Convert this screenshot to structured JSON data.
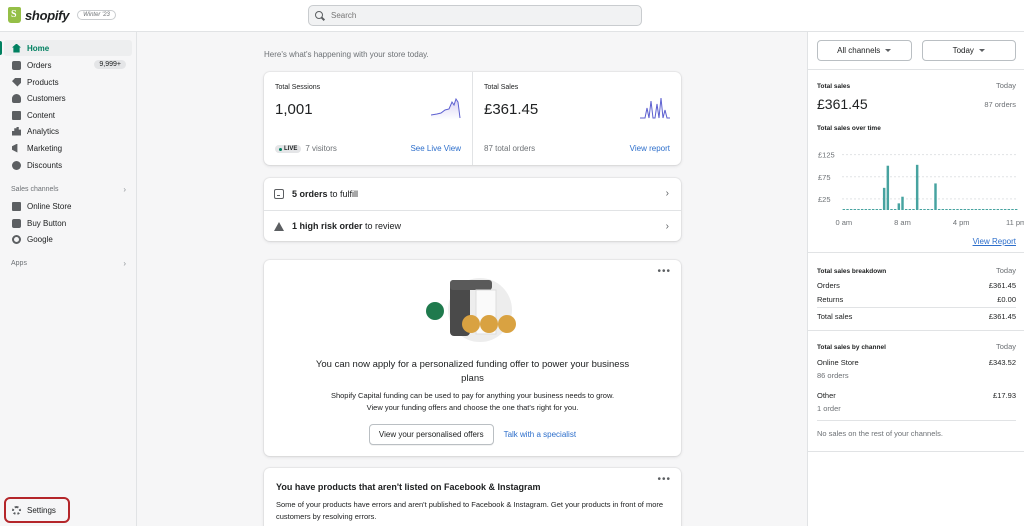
{
  "topbar": {
    "brand": "shopify",
    "edition_badge": "Winter '23",
    "search_placeholder": "Search"
  },
  "sidebar": {
    "items": [
      {
        "label": "Home",
        "icon": "home-icon"
      },
      {
        "label": "Orders",
        "icon": "orders-icon",
        "badge": "9,999+"
      },
      {
        "label": "Products",
        "icon": "tag-icon"
      },
      {
        "label": "Customers",
        "icon": "person-icon"
      },
      {
        "label": "Content",
        "icon": "content-icon"
      },
      {
        "label": "Analytics",
        "icon": "bar-chart-icon"
      },
      {
        "label": "Marketing",
        "icon": "megaphone-icon"
      },
      {
        "label": "Discounts",
        "icon": "discount-icon"
      }
    ],
    "sales_channels_heading": "Sales channels",
    "channels": [
      {
        "label": "Online Store",
        "icon": "store-icon"
      },
      {
        "label": "Buy Button",
        "icon": "buy-button-icon"
      },
      {
        "label": "Google",
        "icon": "google-icon"
      }
    ],
    "apps_heading": "Apps",
    "settings_label": "Settings"
  },
  "main": {
    "intro": "Here's what's happening with your store today.",
    "sessions": {
      "label": "Total Sessions",
      "value": "1,001",
      "live_badge": "LIVE",
      "visitors": "7 visitors",
      "link": "See Live View"
    },
    "sales": {
      "label": "Total Sales",
      "value": "£361.45",
      "orders": "87 total orders",
      "link": "View report"
    },
    "todos": [
      {
        "bold": "5 orders",
        "rest": " to fulfill"
      },
      {
        "bold": "1 high risk order",
        "rest": " to review"
      }
    ],
    "promo": {
      "title": "You can now apply for a personalized funding offer to power your business plans",
      "body": "Shopify Capital funding can be used to pay for anything your business needs to grow. View your funding offers and choose the one that's right for you.",
      "primary_button": "View your personalised offers",
      "secondary_link": "Talk with a specialist"
    },
    "facebook": {
      "title": "You have products that aren't listed on Facebook & Instagram",
      "body": "Some of your products have errors and aren't published to Facebook & Instagram. Get your products in front of more customers by resolving errors."
    }
  },
  "right_panel": {
    "channel_filter": "All channels",
    "date_filter": "Today",
    "total_sales": {
      "heading": "Total sales",
      "period": "Today",
      "value": "£361.45",
      "orders": "87 orders"
    },
    "chart_title": "Total sales over time",
    "chart_link": "View Report",
    "breakdown": {
      "heading": "Total sales breakdown",
      "period": "Today",
      "rows": [
        {
          "label": "Orders",
          "value": "£361.45"
        },
        {
          "label": "Returns",
          "value": "£0.00"
        },
        {
          "label": "Total sales",
          "value": "£361.45"
        }
      ]
    },
    "by_channel": {
      "heading": "Total sales by channel",
      "period": "Today",
      "channels": [
        {
          "name": "Online Store",
          "orders": "86 orders",
          "value": "£343.52"
        },
        {
          "name": "Other",
          "orders": "1 order",
          "value": "£17.93"
        }
      ],
      "note": "No sales on the rest of your channels."
    }
  },
  "chart_data": {
    "type": "bar",
    "title": "Total sales over time",
    "x_tick_labels": [
      "0 am",
      "8 am",
      "4 pm",
      "11 pm"
    ],
    "y_tick_labels": [
      "£125",
      "£75",
      "£25"
    ],
    "ylim": [
      0,
      140
    ],
    "color": "#47a3a0",
    "values": [
      0,
      0,
      0,
      0,
      0,
      0,
      0,
      0,
      0,
      0,
      0,
      50,
      100,
      0,
      0,
      15,
      30,
      0,
      0,
      0,
      102,
      0,
      0,
      0,
      0,
      60,
      0,
      0,
      0,
      0,
      0,
      0,
      0,
      0,
      0,
      0,
      0,
      0,
      0,
      0,
      0,
      0,
      0,
      0,
      0,
      0,
      0,
      0
    ]
  },
  "colors": {
    "accent": "#008060",
    "link": "#2c6ecb",
    "settings_highlight": "#b4262a"
  }
}
